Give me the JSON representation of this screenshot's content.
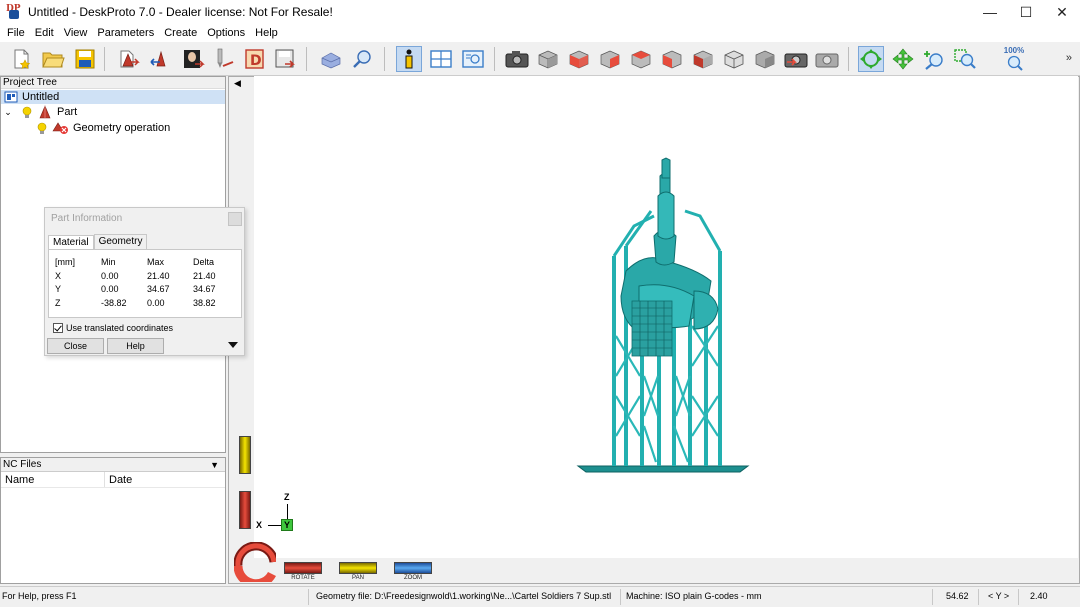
{
  "window": {
    "title": "Untitled - DeskProto 7.0 - Dealer license: Not For Resale!",
    "controls": {
      "minimize": "—",
      "maximize": "☐",
      "close": "✕"
    }
  },
  "menu": [
    "File",
    "Edit",
    "View",
    "Parameters",
    "Create",
    "Options",
    "Help"
  ],
  "toolbar": {
    "zoom_percent": "100%",
    "more": "»",
    "icons": [
      "new-file-icon",
      "open-folder-icon",
      "save-icon",
      "import-part-icon",
      "move-part-icon",
      "part-image-icon",
      "tool-icon",
      "drawing-icon",
      "export-icon",
      "render-icon",
      "inspect-icon",
      "info-icon",
      "layout-icon",
      "preview-icon",
      "camera-icon",
      "view-cube-icons",
      "rotate-view-icon",
      "pan-view-icon",
      "zoom-in-icon",
      "zoom-window-icon",
      "zoom-100-icon"
    ]
  },
  "project_tree": {
    "header": "Project Tree",
    "root": "Untitled",
    "part": "Part",
    "operation": "Geometry operation"
  },
  "nc_files": {
    "header": "NC Files",
    "columns": [
      "Name",
      "Date"
    ]
  },
  "part_info": {
    "title": "Part Information",
    "tabs": [
      "Material",
      "Geometry"
    ],
    "header": [
      "[mm]",
      "Min",
      "Max",
      "Delta"
    ],
    "rows": [
      [
        "X",
        "0.00",
        "21.40",
        "21.40"
      ],
      [
        "Y",
        "0.00",
        "34.67",
        "34.67"
      ],
      [
        "Z",
        "-38.82",
        "0.00",
        "38.82"
      ]
    ],
    "checkbox_label": "Use translated coordinates",
    "close_label": "Close",
    "help_label": "Help"
  },
  "viewport": {
    "axes": {
      "z": "Z",
      "x": "X",
      "y": "Y"
    },
    "widgets": {
      "rotate": "ROTATE",
      "pan": "PAN",
      "zoom": "ZOOM"
    },
    "model_color": "#2aa8a8"
  },
  "status": {
    "help": "For Help, press F1",
    "geometry_file": "Geometry file: D:\\Freedesignwold\\1.working\\Ne...\\Cartel Soldiers 7 Sup.stl",
    "machine": "Machine: ISO plain G-codes - mm",
    "coord_value": "54.62",
    "coord_axis": "< Y >",
    "coord_value2": "2.40"
  }
}
